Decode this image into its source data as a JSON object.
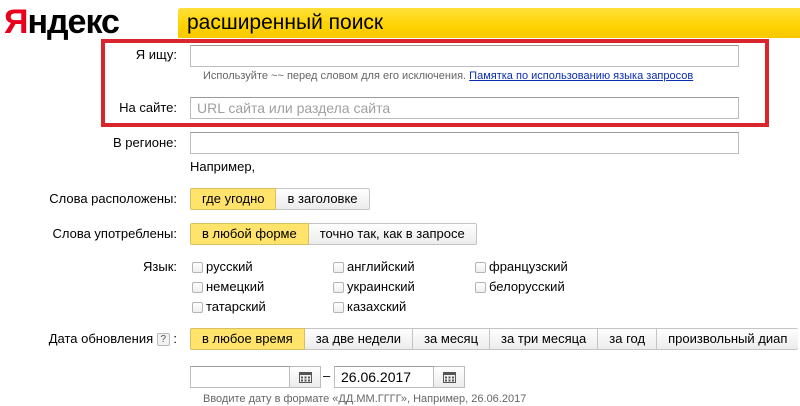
{
  "header": {
    "logo_first": "Я",
    "logo_rest": "ндекс",
    "title": "расширенный поиск"
  },
  "query": {
    "label": "Я ищу:",
    "value": "",
    "placeholder": "",
    "hint_text": "Используйте ~~ перед словом для его исключения.",
    "hint_link": "Памятка по использованию языка запросов"
  },
  "site": {
    "label": "На сайте:",
    "value": "",
    "placeholder": "URL сайта или раздела сайта"
  },
  "region": {
    "label": "В регионе:",
    "value": "",
    "example": "Например,"
  },
  "word_position": {
    "label": "Слова расположены:",
    "options": [
      "где угодно",
      "в заголовке"
    ],
    "selected": "где угодно"
  },
  "word_form": {
    "label": "Слова употреблены:",
    "options": [
      "в любой форме",
      "точно так, как в запросе"
    ],
    "selected": "в любой форме"
  },
  "language": {
    "label": "Язык:",
    "options": [
      "русский",
      "английский",
      "французский",
      "немецкий",
      "украинский",
      "белорусский",
      "татарский",
      "казахский"
    ]
  },
  "date": {
    "label": "Дата обновления",
    "help": "?",
    "colon": ":",
    "options": [
      "в любое время",
      "за две недели",
      "за месяц",
      "за три месяца",
      "за год",
      "произвольный диап"
    ],
    "selected": "в любое время",
    "from_value": "",
    "dash": "–",
    "to_value": "26.06.2017",
    "hint": "Вводите дату в формате «ДД.ММ.ГГГГ», Например, 26.06.2017"
  },
  "colors": {
    "brand_red": "#e8001d",
    "header_yellow": "#ffd200",
    "active_yellow": "#ffe36b",
    "highlight_red": "#d9252c",
    "link_blue": "#0a2db5"
  }
}
